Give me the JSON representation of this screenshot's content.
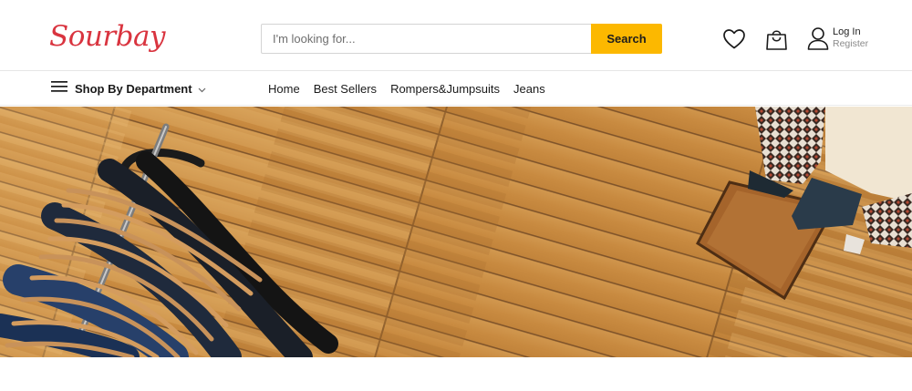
{
  "brand": {
    "logo_text": "Sourbay",
    "logo_color": "#d9343f"
  },
  "search": {
    "placeholder": "I'm looking for...",
    "button_label": "Search",
    "button_color": "#fcb800"
  },
  "header_icons": {
    "wishlist_icon": "heart-icon",
    "cart_icon": "shopping-bag-icon",
    "user_icon": "user-icon"
  },
  "account": {
    "login_label": "Log In",
    "register_label": "Register"
  },
  "nav": {
    "department_label": "Shop By Department",
    "items": [
      {
        "label": "Home"
      },
      {
        "label": "Best Sellers"
      },
      {
        "label": "Rompers&Jumpsuits"
      },
      {
        "label": "Jeans"
      }
    ]
  },
  "hero": {
    "image": "wood-floor-clothing-rack-photo"
  }
}
